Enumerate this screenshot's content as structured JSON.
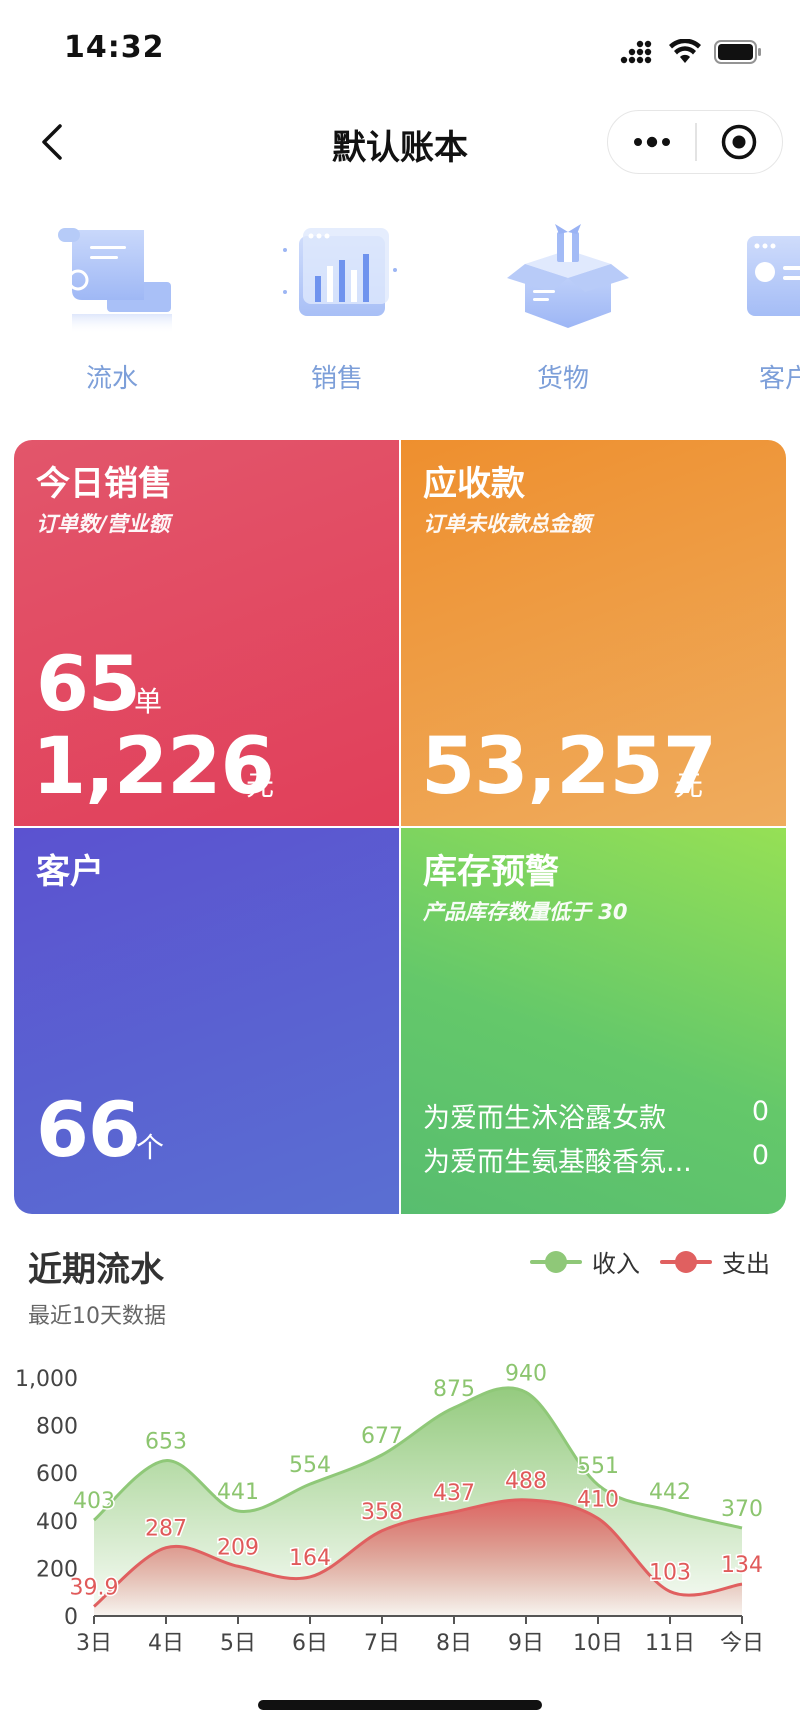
{
  "status_bar": {
    "time": "14:32"
  },
  "nav": {
    "title": "默认账本"
  },
  "shortcuts": [
    {
      "label": "流水",
      "icon": "ledger-scroll-icon"
    },
    {
      "label": "销售",
      "icon": "bar-chart-icon"
    },
    {
      "label": "货物",
      "icon": "gift-box-icon"
    },
    {
      "label": "客户",
      "icon": "customer-card-icon"
    }
  ],
  "tiles": {
    "sales": {
      "title": "今日销售",
      "subtitle": "订单数/营业额",
      "orders": "65",
      "orders_unit": "单",
      "revenue": "1,226",
      "revenue_unit": "元"
    },
    "receivable": {
      "title": "应收款",
      "subtitle": "订单未收款总金额",
      "amount": "53,257",
      "unit": "元"
    },
    "customers": {
      "title": "客户",
      "count": "66",
      "unit": "个"
    },
    "stock": {
      "title": "库存预警",
      "subtitle": "产品库存数量低于 30",
      "items": [
        {
          "name": "为爱而生沐浴露女款",
          "qty": "0"
        },
        {
          "name": "为爱而生氨基酸香氛...",
          "qty": "0"
        }
      ]
    }
  },
  "chart": {
    "title": "近期流水",
    "subtitle": "最近10天数据",
    "legend_income": "收入",
    "legend_expense": "支出"
  },
  "colors": {
    "income": "#8fc878",
    "expense": "#e06060",
    "income_label": "#8cc56f",
    "expense_label": "#e05a5a"
  },
  "chart_data": {
    "type": "area",
    "categories": [
      "3日",
      "4日",
      "5日",
      "6日",
      "7日",
      "8日",
      "9日",
      "10日",
      "11日",
      "今日"
    ],
    "series": [
      {
        "name": "收入",
        "values": [
          403,
          653,
          441,
          554,
          677,
          875,
          940,
          551,
          442,
          370
        ]
      },
      {
        "name": "支出",
        "values": [
          39.9,
          287,
          209,
          164,
          358,
          437,
          488,
          410,
          103,
          134
        ]
      }
    ],
    "yticks": [
      "0",
      "200",
      "400",
      "600",
      "800",
      "1,000"
    ],
    "ylim": [
      0,
      1000
    ]
  }
}
